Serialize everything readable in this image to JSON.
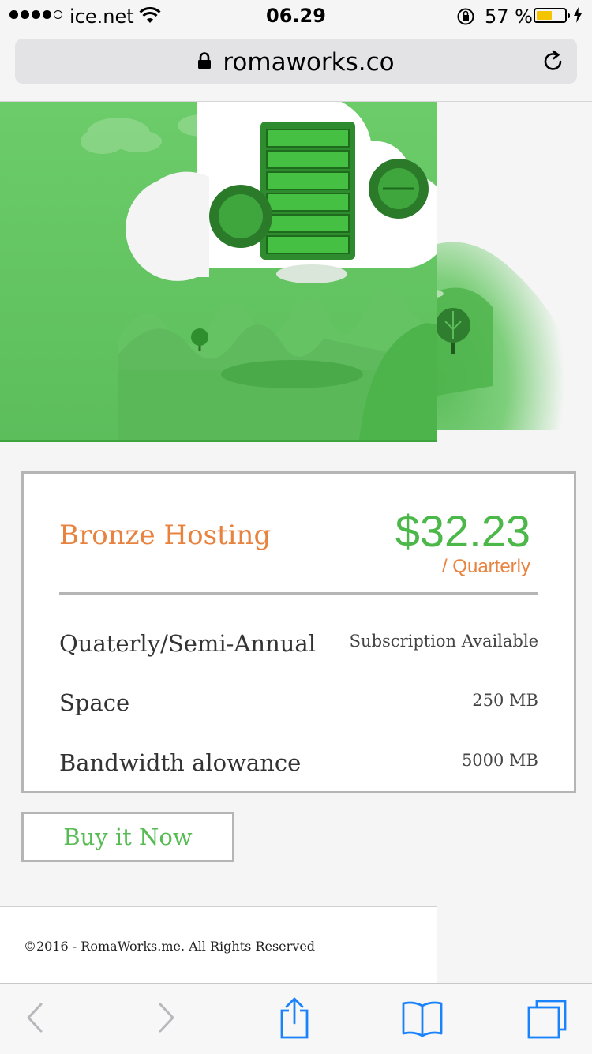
{
  "status_bar": {
    "carrier": "ice.net",
    "time": "06.29",
    "battery_percent_text": "57 %",
    "battery_level": 0.57,
    "icons": [
      "signal-dots-icon",
      "wifi-icon",
      "rotation-lock-icon",
      "battery-icon",
      "charging-bolt-icon"
    ]
  },
  "address_bar": {
    "url": "romaworks.co",
    "icons": [
      "padlock-icon",
      "reload-icon"
    ]
  },
  "hero": {
    "illustration": "cloud-server-illustration"
  },
  "plan": {
    "name": "Bronze Hosting",
    "price": "$32.23",
    "period": "/ Quarterly",
    "features": [
      {
        "label": "Quaterly/Semi-Annual",
        "value": "Subscription Available"
      },
      {
        "label": "Space",
        "value": "250 MB"
      },
      {
        "label": "Bandwidth alowance",
        "value": "5000 MB"
      }
    ]
  },
  "buy_button": {
    "label": "Buy it Now"
  },
  "footer": {
    "copyright": "©2016 - RomaWorks.me. All Rights Reserved"
  },
  "toolbar": {
    "icons": [
      "back-icon",
      "forward-icon",
      "share-icon",
      "bookmarks-icon",
      "tabs-icon"
    ]
  },
  "colors": {
    "accent_orange": "#e8823f",
    "price_green": "#4cb84a",
    "button_green": "#55bb52",
    "hero_green": "#6dc86b",
    "toolbar_blue": "#1a82fb"
  }
}
